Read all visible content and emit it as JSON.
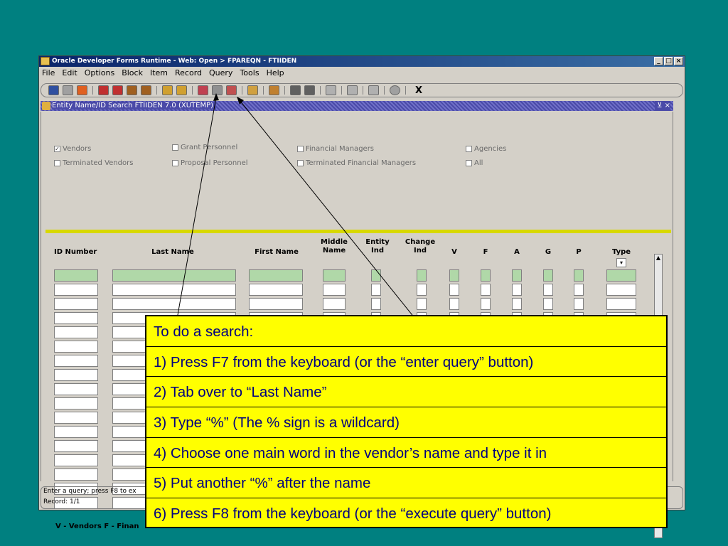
{
  "window": {
    "title": "Oracle Developer Forms Runtime - Web:  Open > FPAREQN - FTIIDEN",
    "buttons": [
      "_",
      "□",
      "×"
    ]
  },
  "menu": [
    "File",
    "Edit",
    "Options",
    "Block",
    "Item",
    "Record",
    "Query",
    "Tools",
    "Help"
  ],
  "toolbar": {
    "exit_label": "X"
  },
  "form": {
    "title": "Entity Name/ID Search  FTIIDEN  7.0  (XUTEMP)",
    "controls": "⊻ ×",
    "checkboxes": [
      {
        "label": "Vendors",
        "checked": true
      },
      {
        "label": "Grant Personnel",
        "checked": false
      },
      {
        "label": "Financial Managers",
        "checked": false
      },
      {
        "label": "Agencies",
        "checked": false
      },
      {
        "label": "Terminated Vendors",
        "checked": false
      },
      {
        "label": "Proposal Personnel",
        "checked": false
      },
      {
        "label": "Terminated Financial Managers",
        "checked": false
      },
      {
        "label": "All",
        "checked": false
      }
    ],
    "columns": [
      {
        "label": "ID Number"
      },
      {
        "label": "Last Name"
      },
      {
        "label": "First Name"
      },
      {
        "label": "Middle Name"
      },
      {
        "label": "Entity Ind"
      },
      {
        "label": "Change Ind"
      },
      {
        "label": "V"
      },
      {
        "label": "F"
      },
      {
        "label": "A"
      },
      {
        "label": "G"
      },
      {
        "label": "P"
      },
      {
        "label": "Type"
      }
    ],
    "legend": "V - Vendors   F - Finan"
  },
  "status": {
    "line1": "Enter a query;  press F8 to ex",
    "line2": "Record: 1/1"
  },
  "callout": {
    "rows": [
      "To do a search:",
      "1)  Press F7 from the keyboard (or the “enter query” button)",
      "2)  Tab over to “Last Name”",
      "3)  Type “%” (The % sign is a wildcard)",
      "4)  Choose one main word in the vendor’s name and type it in",
      "5)  Put another “%” after the name",
      "6)  Press F8 from the keyboard (or the “execute query” button)"
    ]
  },
  "colors": {
    "desktop": "#008080",
    "callout_bg": "#ffff00",
    "callout_text": "#000080",
    "selected_row": "#b0d8a8"
  }
}
